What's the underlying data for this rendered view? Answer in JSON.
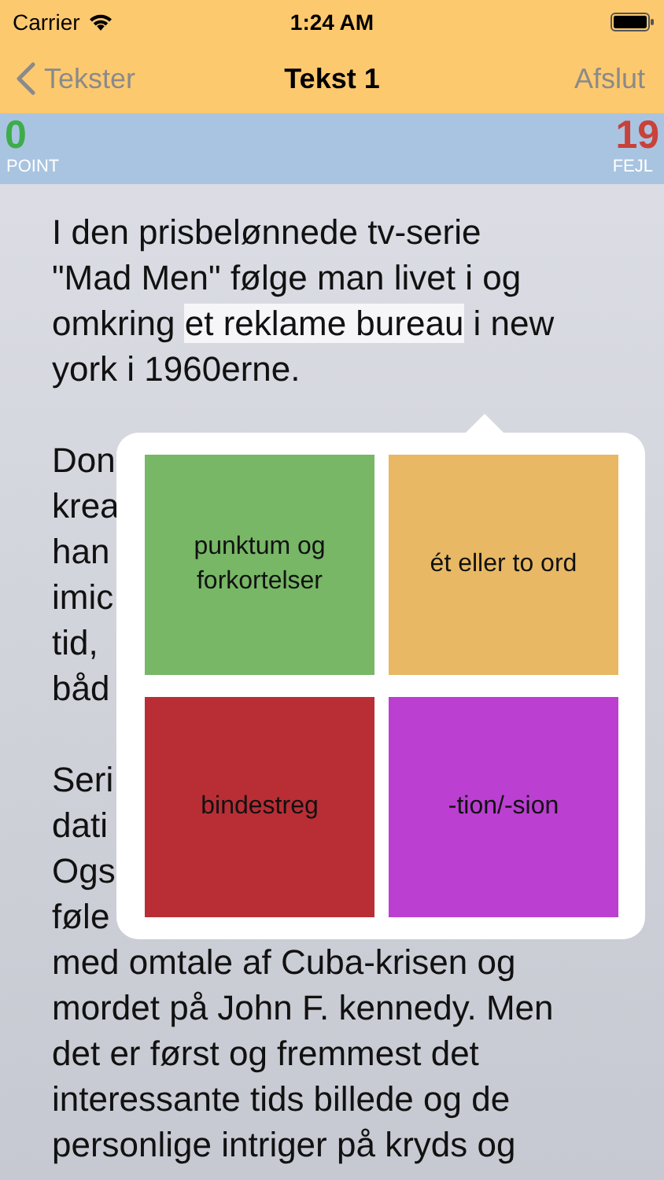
{
  "status_bar": {
    "carrier": "Carrier",
    "time": "1:24 AM"
  },
  "nav": {
    "back": "Tekster",
    "title": "Tekst 1",
    "action": "Afslut"
  },
  "score": {
    "points": "0",
    "points_label": "POINT",
    "errors": "19",
    "errors_label": "FEJL"
  },
  "paragraphs": [
    [
      [
        {
          "text": "I den prisbelønnede tv-serie",
          "highlighted": false
        }
      ],
      [
        {
          "text": "\"Mad Men\" følge man livet i og",
          "highlighted": false
        }
      ],
      [
        {
          "text": "omkring ",
          "highlighted": false
        },
        {
          "text": "et reklame bureau",
          "highlighted": true
        },
        {
          "text": " i new",
          "highlighted": false
        }
      ],
      [
        {
          "text": "york i 1960erne.",
          "highlighted": false
        }
      ]
    ],
    [
      [
        {
          "text": "Don",
          "highlighted": false
        }
      ],
      [
        {
          "text": "krea",
          "highlighted": false
        }
      ],
      [
        {
          "text": "han",
          "highlighted": false
        }
      ],
      [
        {
          "text": "imic",
          "highlighted": false
        }
      ],
      [
        {
          "text": "tid,",
          "highlighted": false
        }
      ],
      [
        {
          "text": "båd",
          "highlighted": false
        }
      ]
    ],
    [
      [
        {
          "text": "Seri",
          "highlighted": false
        }
      ],
      [
        {
          "text": "dati",
          "highlighted": false
        }
      ],
      [
        {
          "text": "Ogs",
          "highlighted": false
        }
      ],
      [
        {
          "text": "føle",
          "highlighted": false
        }
      ],
      [
        {
          "text": "med omtale af Cuba-krisen og",
          "highlighted": false
        }
      ],
      [
        {
          "text": "mordet på John F. kennedy. Men",
          "highlighted": false
        }
      ],
      [
        {
          "text": "det er først og fremmest det",
          "highlighted": false
        }
      ],
      [
        {
          "text": "interessante tids billede og de",
          "highlighted": false
        }
      ],
      [
        {
          "text": "personlige intriger på kryds og",
          "highlighted": false
        }
      ]
    ]
  ],
  "categories": [
    {
      "label": "punktum og forkortelser",
      "color": "#77b766"
    },
    {
      "label": "ét eller to ord",
      "color": "#e8b864"
    },
    {
      "label": "bindestreg",
      "color": "#b92e35"
    },
    {
      "label": "-tion/-sion",
      "color": "#bb3fd1"
    }
  ]
}
